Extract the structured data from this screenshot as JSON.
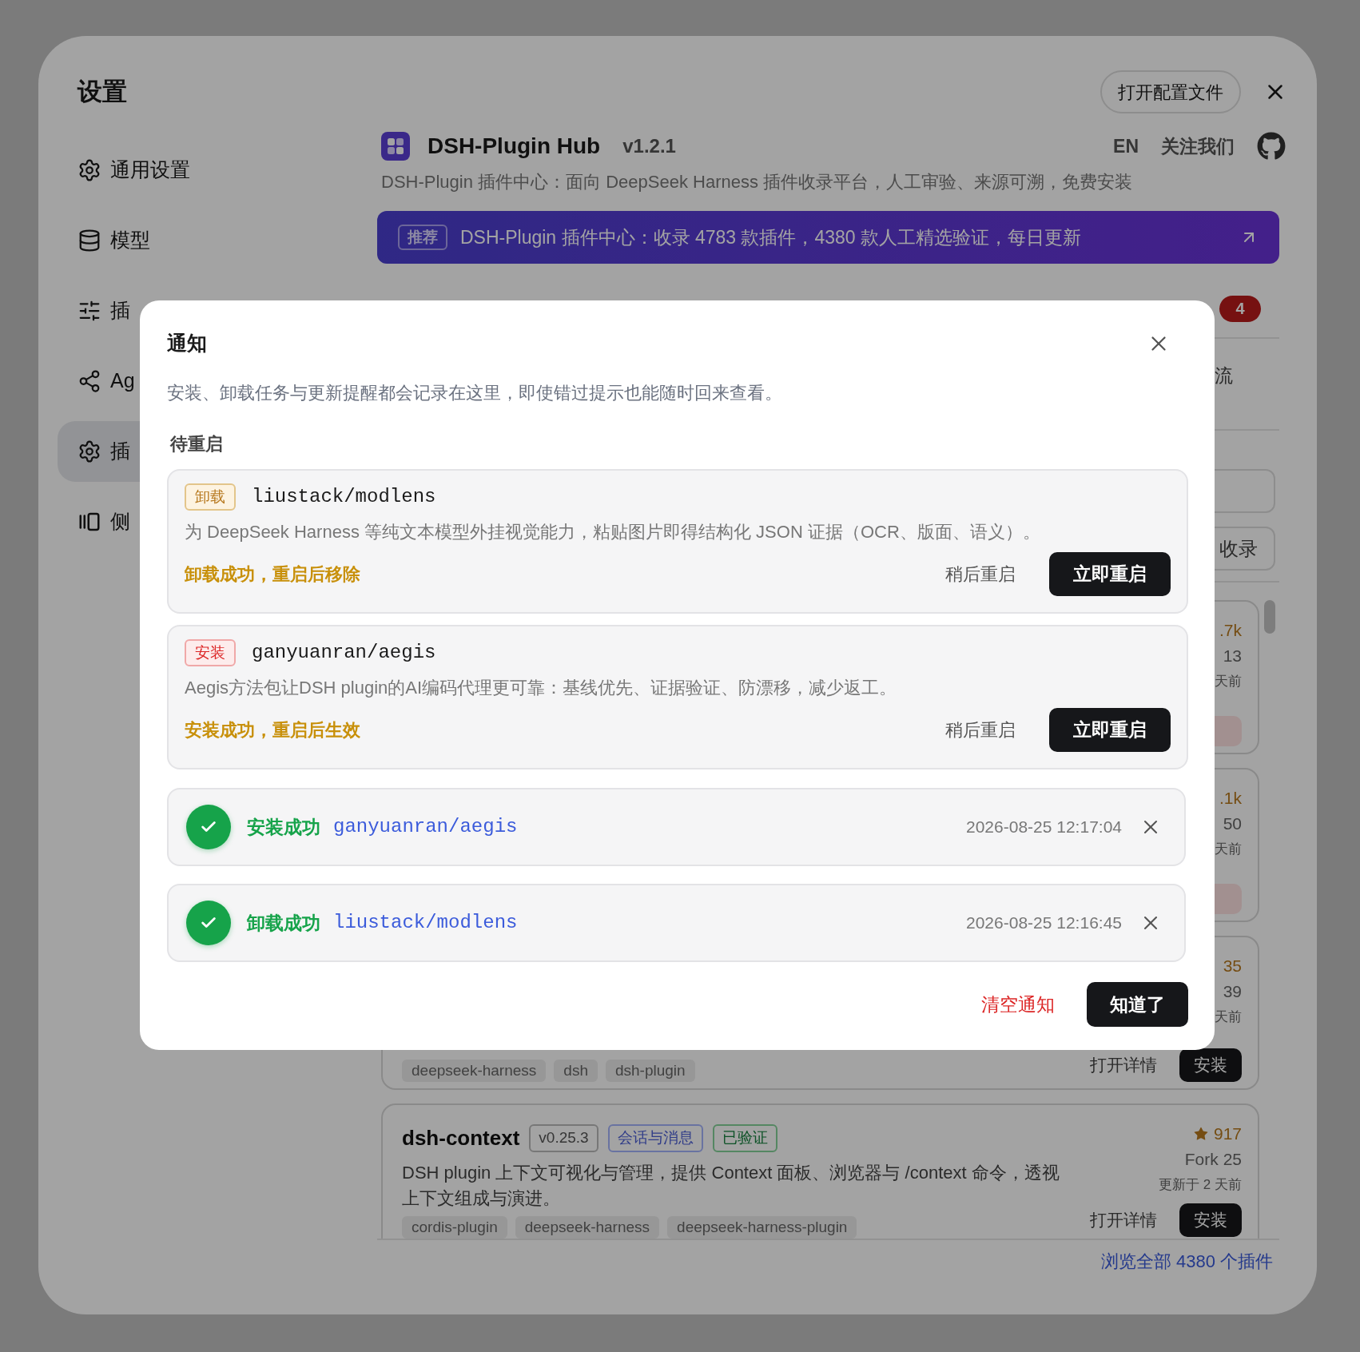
{
  "settings": {
    "title": "设置",
    "open_config_button": "打开配置文件",
    "sidebar": [
      {
        "label": "通用设置",
        "selected": false
      },
      {
        "label": "模型",
        "selected": false
      },
      {
        "label": "插",
        "selected": false
      },
      {
        "label": "Ag",
        "selected": false
      },
      {
        "label": "插",
        "selected": true
      },
      {
        "label": "侧",
        "selected": false
      }
    ]
  },
  "hub": {
    "name": "DSH-Plugin Hub",
    "version": "v1.2.1",
    "language": "EN",
    "follow": "关注我们",
    "subtitle": "DSH-Plugin 插件中心：面向 DeepSeek Harness 插件收录平台，人工审验、来源可溯，免费安装",
    "banner": {
      "tag": "推荐",
      "text": "DSH-Plugin 插件中心：收录 4783 款插件，4380 款人工精选验证，每日更新"
    },
    "notification_count": "4",
    "tab_fragment": "流",
    "new_button_fragment": "收录",
    "plugins": [
      {
        "kind": "installed",
        "star_count": ".7k",
        "forks": "13",
        "updated": "天前"
      },
      {
        "kind": "installed",
        "star_count": ".1k",
        "forks": "50",
        "updated": "天前"
      },
      {
        "kind": "available",
        "star_count": "35",
        "forks": "39",
        "updated": "天前",
        "tags": [
          "deepseek-harness",
          "dsh",
          "dsh-plugin"
        ],
        "details": "打开详情",
        "install": "安装"
      },
      {
        "kind": "available",
        "name": "dsh-context",
        "version": "v0.25.3",
        "category": "会话与消息",
        "verified": "已验证",
        "description": "DSH plugin 上下文可视化与管理，提供 Context 面板、浏览器与 /context 命令，透视上下文组成与演进。",
        "star_count": "917",
        "forks": "Fork 25",
        "updated": "更新于 2 天前",
        "tags": [
          "cordis-plugin",
          "deepseek-harness",
          "deepseek-harness-plugin"
        ],
        "details": "打开详情",
        "install": "安装"
      }
    ],
    "browse_all": "浏览全部 4380 个插件"
  },
  "notifications": {
    "title": "通知",
    "description": "安装、卸载任务与更新提醒都会记录在这里，即使错过提示也能随时回来查看。",
    "pending_section": "待重启",
    "pending": [
      {
        "kind": "uninstall",
        "action": "卸载",
        "name": "liustack/modlens",
        "description": "为 DeepSeek Harness 等纯文本模型外挂视觉能力，粘贴图片即得结构化 JSON 证据（OCR、版面、语义）。",
        "status": "卸载成功，重启后移除",
        "later": "稍后重启",
        "restart": "立即重启"
      },
      {
        "kind": "install",
        "action": "安装",
        "name": "ganyuanran/aegis",
        "description": "Aegis方法包让DSH plugin的AI编码代理更可靠：基线优先、证据验证、防漂移，减少返工。",
        "status": "安装成功，重启后生效",
        "later": "稍后重启",
        "restart": "立即重启"
      }
    ],
    "history": [
      {
        "result": "安装成功",
        "name": "ganyuanran/aegis",
        "time": "2026-08-25 12:17:04"
      },
      {
        "result": "卸载成功",
        "name": "liustack/modlens",
        "time": "2026-08-25 12:16:45"
      }
    ],
    "clear": "清空通知",
    "ok": "知道了"
  }
}
